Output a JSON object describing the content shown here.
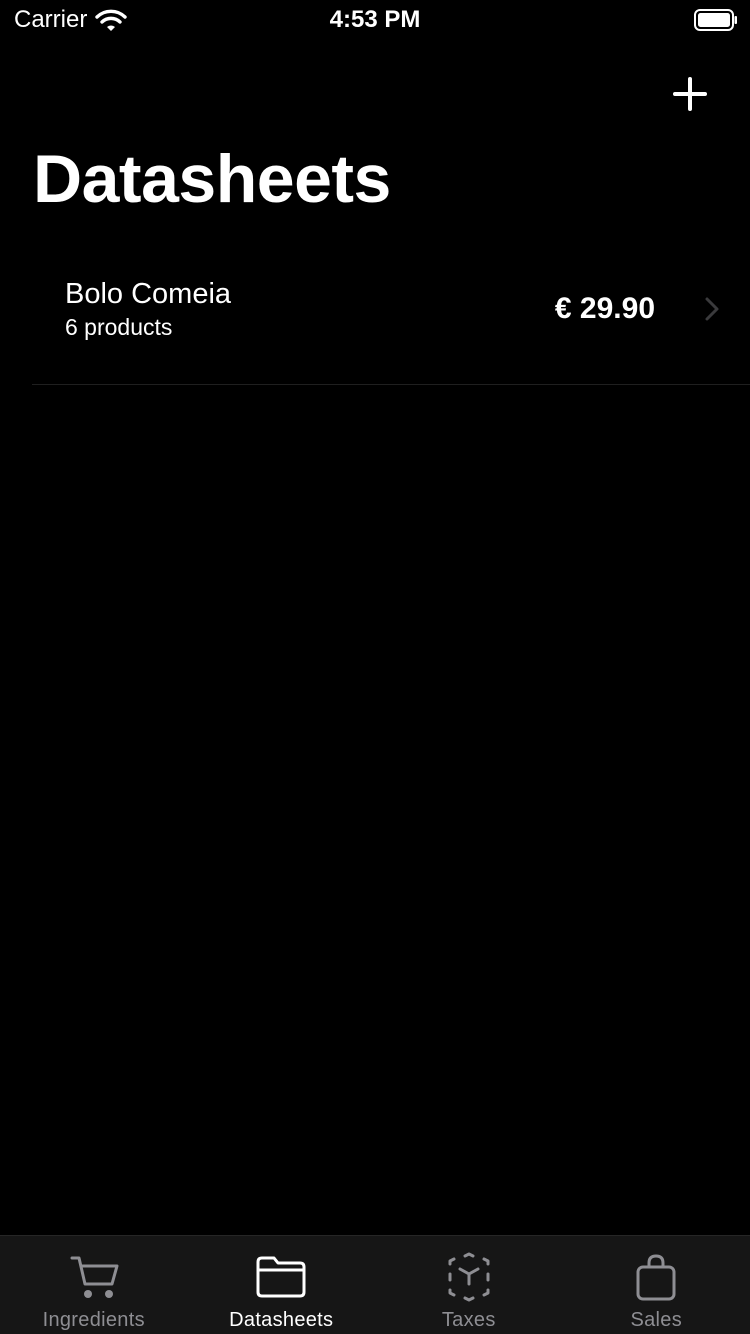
{
  "status_bar": {
    "carrier": "Carrier",
    "time": "4:53 PM"
  },
  "nav": {
    "title": "Datasheets",
    "add_icon": "plus-icon"
  },
  "list": {
    "items": [
      {
        "title": "Bolo Comeia",
        "subtitle": "6 products",
        "price": "€ 29.90"
      }
    ]
  },
  "tabs": [
    {
      "label": "Ingredients",
      "icon": "cart-icon",
      "active": false
    },
    {
      "label": "Datasheets",
      "icon": "folder-icon",
      "active": true
    },
    {
      "label": "Taxes",
      "icon": "box-icon",
      "active": false
    },
    {
      "label": "Sales",
      "icon": "bag-icon",
      "active": false
    }
  ],
  "colors": {
    "background": "#000000",
    "tab_bar": "#161616",
    "inactive": "#8e8e93",
    "active": "#ffffff"
  }
}
